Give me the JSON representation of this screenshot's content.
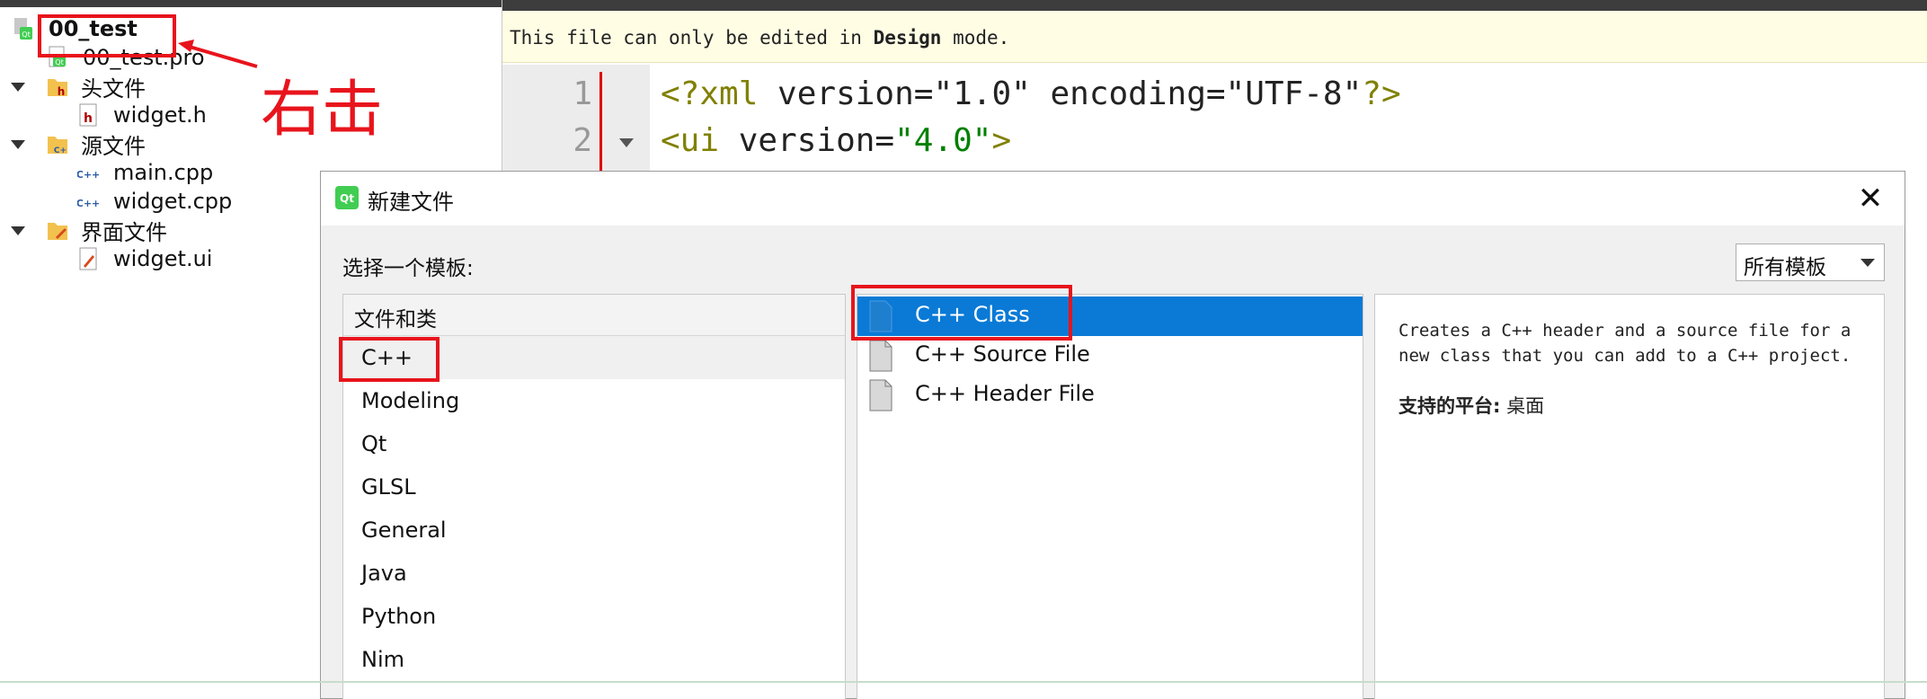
{
  "project_tree": {
    "items": [
      {
        "label": "00_test",
        "icon": "qt-project-icon",
        "bold": true
      },
      {
        "label": "00_test.pro",
        "icon": "qt-pro-file-icon"
      },
      {
        "label": "头文件",
        "icon": "header-folder-icon"
      },
      {
        "label": "widget.h",
        "icon": "header-file-icon"
      },
      {
        "label": "源文件",
        "icon": "source-folder-icon"
      },
      {
        "label": "main.cpp",
        "icon": "cpp-file-icon"
      },
      {
        "label": "widget.cpp",
        "icon": "cpp-file-icon"
      },
      {
        "label": "界面文件",
        "icon": "form-folder-icon"
      },
      {
        "label": "widget.ui",
        "icon": "ui-file-icon"
      }
    ]
  },
  "annotation": {
    "text": "右击",
    "color": "#e8141c"
  },
  "editor": {
    "notice_prefix": "This file can only be edited in ",
    "notice_mode": "Design",
    "notice_suffix": " mode.",
    "lines": [
      {
        "num": "1",
        "tag_open": "<?xml",
        "attrs": " version=\"1.0\" encoding=\"UTF-8\"",
        "tag_close": "?>"
      },
      {
        "num": "2",
        "tag_open": "<ui",
        "attrs": " version=",
        "str": "\"4.0\"",
        "tag_close": ">"
      }
    ]
  },
  "dialog": {
    "title": "新建文件",
    "close": "✕",
    "choose_label": "选择一个模板:",
    "filter_value": "所有模板",
    "categories_header": "文件和类",
    "categories": [
      "C++",
      "Modeling",
      "Qt",
      "GLSL",
      "General",
      "Java",
      "Python",
      "Nim"
    ],
    "selected_category": "C++",
    "templates": [
      "C++ Class",
      "C++ Source File",
      "C++ Header File"
    ],
    "selected_template": "C++ Class",
    "description": "Creates a C++ header and a source file for a new class that you can add to a C++ project.",
    "platform_label": "支持的平台:",
    "platform_value": "桌面"
  },
  "colors": {
    "accent": "#0a7ad6",
    "annotation_red": "#e8141c",
    "notice_bg": "#fffde4"
  }
}
